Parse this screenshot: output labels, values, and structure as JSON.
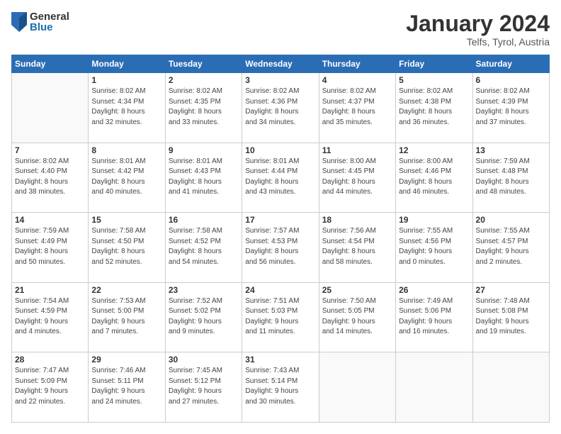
{
  "logo": {
    "general": "General",
    "blue": "Blue"
  },
  "title": "January 2024",
  "subtitle": "Telfs, Tyrol, Austria",
  "days_of_week": [
    "Sunday",
    "Monday",
    "Tuesday",
    "Wednesday",
    "Thursday",
    "Friday",
    "Saturday"
  ],
  "weeks": [
    [
      {
        "day": "",
        "info": ""
      },
      {
        "day": "1",
        "info": "Sunrise: 8:02 AM\nSunset: 4:34 PM\nDaylight: 8 hours\nand 32 minutes."
      },
      {
        "day": "2",
        "info": "Sunrise: 8:02 AM\nSunset: 4:35 PM\nDaylight: 8 hours\nand 33 minutes."
      },
      {
        "day": "3",
        "info": "Sunrise: 8:02 AM\nSunset: 4:36 PM\nDaylight: 8 hours\nand 34 minutes."
      },
      {
        "day": "4",
        "info": "Sunrise: 8:02 AM\nSunset: 4:37 PM\nDaylight: 8 hours\nand 35 minutes."
      },
      {
        "day": "5",
        "info": "Sunrise: 8:02 AM\nSunset: 4:38 PM\nDaylight: 8 hours\nand 36 minutes."
      },
      {
        "day": "6",
        "info": "Sunrise: 8:02 AM\nSunset: 4:39 PM\nDaylight: 8 hours\nand 37 minutes."
      }
    ],
    [
      {
        "day": "7",
        "info": "Sunrise: 8:02 AM\nSunset: 4:40 PM\nDaylight: 8 hours\nand 38 minutes."
      },
      {
        "day": "8",
        "info": "Sunrise: 8:01 AM\nSunset: 4:42 PM\nDaylight: 8 hours\nand 40 minutes."
      },
      {
        "day": "9",
        "info": "Sunrise: 8:01 AM\nSunset: 4:43 PM\nDaylight: 8 hours\nand 41 minutes."
      },
      {
        "day": "10",
        "info": "Sunrise: 8:01 AM\nSunset: 4:44 PM\nDaylight: 8 hours\nand 43 minutes."
      },
      {
        "day": "11",
        "info": "Sunrise: 8:00 AM\nSunset: 4:45 PM\nDaylight: 8 hours\nand 44 minutes."
      },
      {
        "day": "12",
        "info": "Sunrise: 8:00 AM\nSunset: 4:46 PM\nDaylight: 8 hours\nand 46 minutes."
      },
      {
        "day": "13",
        "info": "Sunrise: 7:59 AM\nSunset: 4:48 PM\nDaylight: 8 hours\nand 48 minutes."
      }
    ],
    [
      {
        "day": "14",
        "info": "Sunrise: 7:59 AM\nSunset: 4:49 PM\nDaylight: 8 hours\nand 50 minutes."
      },
      {
        "day": "15",
        "info": "Sunrise: 7:58 AM\nSunset: 4:50 PM\nDaylight: 8 hours\nand 52 minutes."
      },
      {
        "day": "16",
        "info": "Sunrise: 7:58 AM\nSunset: 4:52 PM\nDaylight: 8 hours\nand 54 minutes."
      },
      {
        "day": "17",
        "info": "Sunrise: 7:57 AM\nSunset: 4:53 PM\nDaylight: 8 hours\nand 56 minutes."
      },
      {
        "day": "18",
        "info": "Sunrise: 7:56 AM\nSunset: 4:54 PM\nDaylight: 8 hours\nand 58 minutes."
      },
      {
        "day": "19",
        "info": "Sunrise: 7:55 AM\nSunset: 4:56 PM\nDaylight: 9 hours\nand 0 minutes."
      },
      {
        "day": "20",
        "info": "Sunrise: 7:55 AM\nSunset: 4:57 PM\nDaylight: 9 hours\nand 2 minutes."
      }
    ],
    [
      {
        "day": "21",
        "info": "Sunrise: 7:54 AM\nSunset: 4:59 PM\nDaylight: 9 hours\nand 4 minutes."
      },
      {
        "day": "22",
        "info": "Sunrise: 7:53 AM\nSunset: 5:00 PM\nDaylight: 9 hours\nand 7 minutes."
      },
      {
        "day": "23",
        "info": "Sunrise: 7:52 AM\nSunset: 5:02 PM\nDaylight: 9 hours\nand 9 minutes."
      },
      {
        "day": "24",
        "info": "Sunrise: 7:51 AM\nSunset: 5:03 PM\nDaylight: 9 hours\nand 11 minutes."
      },
      {
        "day": "25",
        "info": "Sunrise: 7:50 AM\nSunset: 5:05 PM\nDaylight: 9 hours\nand 14 minutes."
      },
      {
        "day": "26",
        "info": "Sunrise: 7:49 AM\nSunset: 5:06 PM\nDaylight: 9 hours\nand 16 minutes."
      },
      {
        "day": "27",
        "info": "Sunrise: 7:48 AM\nSunset: 5:08 PM\nDaylight: 9 hours\nand 19 minutes."
      }
    ],
    [
      {
        "day": "28",
        "info": "Sunrise: 7:47 AM\nSunset: 5:09 PM\nDaylight: 9 hours\nand 22 minutes."
      },
      {
        "day": "29",
        "info": "Sunrise: 7:46 AM\nSunset: 5:11 PM\nDaylight: 9 hours\nand 24 minutes."
      },
      {
        "day": "30",
        "info": "Sunrise: 7:45 AM\nSunset: 5:12 PM\nDaylight: 9 hours\nand 27 minutes."
      },
      {
        "day": "31",
        "info": "Sunrise: 7:43 AM\nSunset: 5:14 PM\nDaylight: 9 hours\nand 30 minutes."
      },
      {
        "day": "",
        "info": ""
      },
      {
        "day": "",
        "info": ""
      },
      {
        "day": "",
        "info": ""
      }
    ]
  ]
}
